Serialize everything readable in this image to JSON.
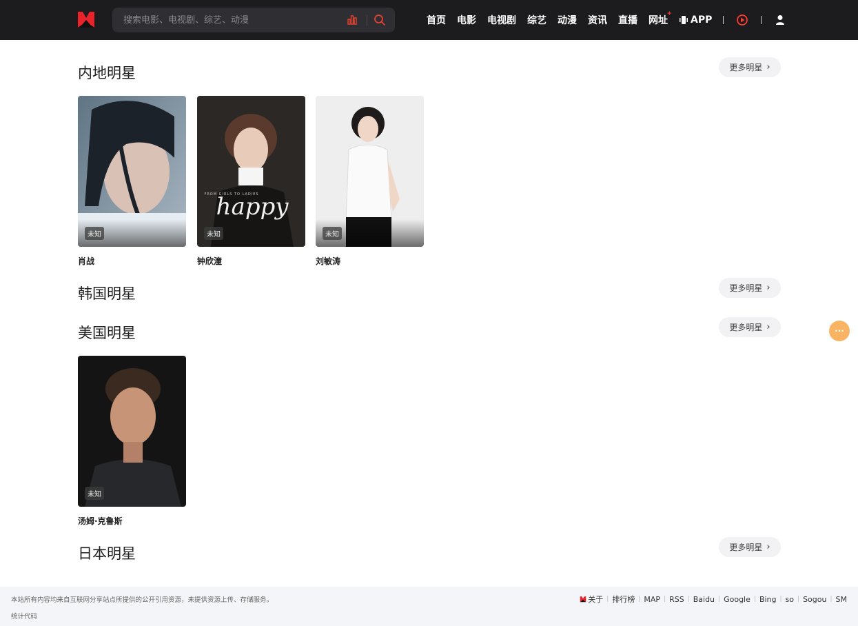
{
  "header": {
    "search_placeholder": "搜索电影、电视剧、综艺、动漫",
    "nav": [
      "首页",
      "电影",
      "电视剧",
      "综艺",
      "动漫",
      "资讯",
      "直播",
      "网址"
    ],
    "nav_badge": "+",
    "app_label": "APP"
  },
  "sections": [
    {
      "title": "内地明星",
      "more": "更多明星",
      "chev": "›",
      "cards": [
        {
          "name": "肖战",
          "tag": "未知"
        },
        {
          "name": "钟欣潼",
          "tag": "未知",
          "photo_text": "happy",
          "photo_subtext": "FROM GIRLS TO LADIES"
        },
        {
          "name": "刘敏涛",
          "tag": "未知"
        }
      ]
    },
    {
      "title": "韩国明星",
      "more": "更多明星",
      "chev": "›",
      "cards": []
    },
    {
      "title": "美国明星",
      "more": "更多明星",
      "chev": "›",
      "cards": [
        {
          "name": "汤姆·克鲁斯",
          "tag": "未知"
        }
      ]
    },
    {
      "title": "日本明星",
      "more": "更多明星",
      "chev": "›",
      "cards": []
    }
  ],
  "float_label": "···",
  "footer": {
    "notice": "本站所有内容均来自互联网分享站点所提供的公开引用资源，未提供资源上传、存储服务。",
    "stat": "统计代码",
    "links": [
      "关于",
      "排行榜",
      "MAP",
      "RSS",
      "Baidu",
      "Google",
      "Bing",
      "so",
      "Sogou",
      "SM"
    ],
    "sep": "|"
  },
  "colors": {
    "header_bg": "#1c1c1e",
    "accent": "#ff3b30",
    "float": "#f9b463",
    "footer_bg": "#f4f5f8"
  }
}
